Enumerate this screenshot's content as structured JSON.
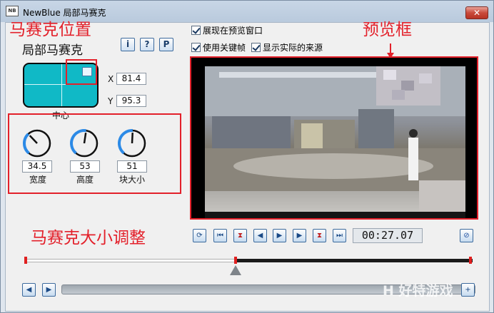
{
  "window": {
    "icon_text": "NB",
    "title": "NewBlue 局部马赛克",
    "close_label": "✕"
  },
  "annotations": {
    "position": "马赛克位置",
    "preview": "预览框",
    "size": "马赛克大小调整"
  },
  "plugin": {
    "title": "局部马赛克",
    "info_btn": "i",
    "help_btn": "?",
    "preset_btn": "P"
  },
  "position": {
    "caption": "中心",
    "x_label": "X",
    "x_value": "81.4",
    "y_label": "Y",
    "y_value": "95.3"
  },
  "knobs": [
    {
      "label": "宽度",
      "value": "34.5",
      "level": 0.345
    },
    {
      "label": "高度",
      "value": "53",
      "level": 0.53
    },
    {
      "label": "块大小",
      "value": "51",
      "level": 0.51
    }
  ],
  "options": {
    "show_in_preview": "展现在预览窗口",
    "use_keyframes": "使用关键帧",
    "show_actual_source": "显示实际的来源"
  },
  "transport": {
    "timecode": "00:27.07"
  },
  "watermark": {
    "text": "H 好特游戏"
  },
  "colors": {
    "accent": "#e3202a",
    "position_pad": "#10b9c6"
  }
}
